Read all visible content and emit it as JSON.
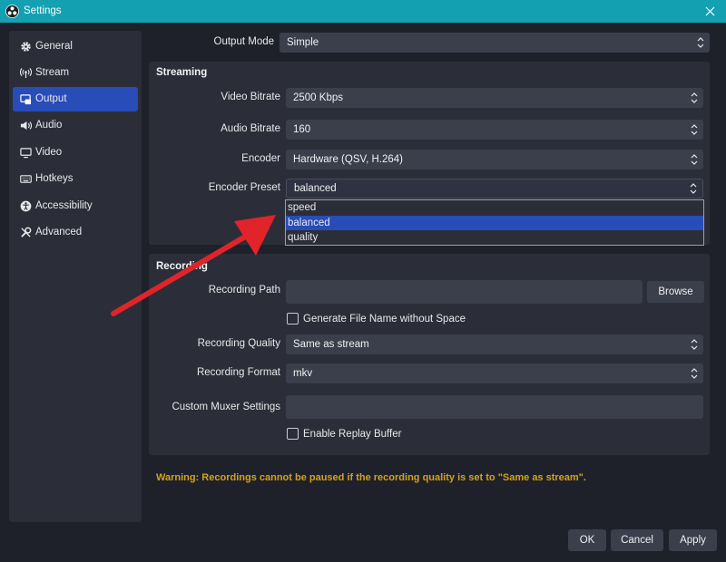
{
  "window": {
    "title": "Settings"
  },
  "sidebar": {
    "items": [
      {
        "label": "General",
        "icon": "gear-icon"
      },
      {
        "label": "Stream",
        "icon": "antenna-icon"
      },
      {
        "label": "Output",
        "icon": "output-icon",
        "active": true
      },
      {
        "label": "Audio",
        "icon": "speaker-icon"
      },
      {
        "label": "Video",
        "icon": "monitor-icon"
      },
      {
        "label": "Hotkeys",
        "icon": "keyboard-icon"
      },
      {
        "label": "Accessibility",
        "icon": "accessibility-icon"
      },
      {
        "label": "Advanced",
        "icon": "wrench-icon"
      }
    ]
  },
  "output": {
    "mode_label": "Output Mode",
    "mode_value": "Simple"
  },
  "streaming": {
    "title": "Streaming",
    "video_bitrate_label": "Video Bitrate",
    "video_bitrate_value": "2500 Kbps",
    "audio_bitrate_label": "Audio Bitrate",
    "audio_bitrate_value": "160",
    "encoder_label": "Encoder",
    "encoder_value": "Hardware (QSV, H.264)",
    "preset_label": "Encoder Preset",
    "preset_value": "balanced",
    "preset_options": [
      "speed",
      "balanced",
      "quality"
    ]
  },
  "recording": {
    "title": "Recording",
    "path_label": "Recording Path",
    "path_value": "",
    "browse_label": "Browse",
    "no_space_label": "Generate File Name without Space",
    "quality_label": "Recording Quality",
    "quality_value": "Same as stream",
    "format_label": "Recording Format",
    "format_value": "mkv",
    "muxer_label": "Custom Muxer Settings",
    "muxer_value": "",
    "replay_label": "Enable Replay Buffer"
  },
  "warning": "Warning: Recordings cannot be paused if the recording quality is set to \"Same as stream\".",
  "footer": {
    "ok": "OK",
    "cancel": "Cancel",
    "apply": "Apply"
  },
  "colors": {
    "titlebar": "#13a1b2",
    "accent": "#284cb8",
    "warning": "#d4a11e",
    "annotation_arrow": "#e0242a"
  }
}
